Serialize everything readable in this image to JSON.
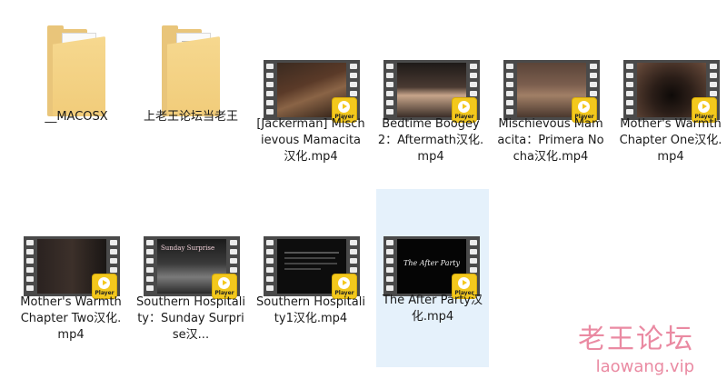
{
  "items": [
    {
      "label": "__MACOSX",
      "type": "folder"
    },
    {
      "label": "上老王论坛当老王",
      "type": "folder"
    },
    {
      "label": "[Jackerman] Mischievous Mamacita汉化.mp4",
      "type": "video"
    },
    {
      "label": "Bedtime Boogey2：Aftermath汉化.mp4",
      "type": "video"
    },
    {
      "label": "Mischievous Mamacita：Primera Nocha汉化.mp4",
      "type": "video"
    },
    {
      "label": "Mother's Warmth Chapter One汉化.mp4",
      "type": "video"
    },
    {
      "label": "Mother's Warmth Chapter Two汉化.mp4",
      "type": "video"
    },
    {
      "label": "Southern Hospitality：Sunday Surprise汉...",
      "type": "video"
    },
    {
      "label": "Southern Hospitality1汉化.mp4",
      "type": "video"
    },
    {
      "label": "The After Party汉化.mp4",
      "type": "video",
      "selected": true
    }
  ],
  "player_badge": "Player",
  "thumb_text": {
    "after_party": "The After Party",
    "southern_sunday": "Sunday Surprise"
  },
  "watermark": {
    "title": "老王论坛",
    "url": "laowang.vip"
  },
  "colors": {
    "selection": "#e5f1fb",
    "badge": "#f3c81d",
    "watermark": "#ea8aa2"
  }
}
